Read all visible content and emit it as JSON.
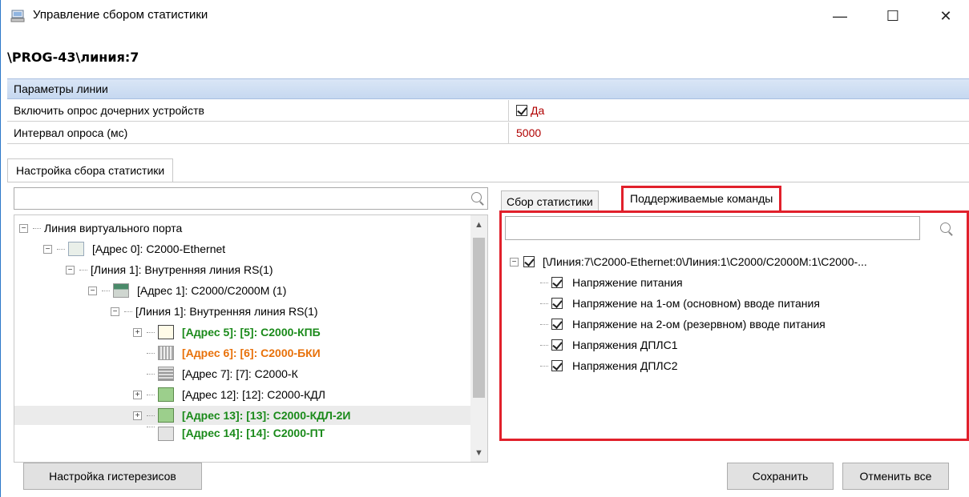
{
  "window": {
    "title": "Управление сбором статистики",
    "path": "\\PROG-43\\линия:7",
    "controls": {
      "minimize": "—",
      "maximize": "☐",
      "close": "✕"
    }
  },
  "params": {
    "header": "Параметры линии",
    "rows": [
      {
        "label": "Включить опрос дочерних устройств",
        "value": "Да",
        "checked": true
      },
      {
        "label": "Интервал опроса (мс)",
        "value": "5000"
      }
    ]
  },
  "main_tab": "Настройка сбора статистики",
  "left_tree": {
    "search_value": "",
    "nodes": [
      {
        "label": "Линия виртуального порта",
        "level": 0,
        "icon": "none"
      },
      {
        "label": "[Адрес 0]: С2000-Ethernet",
        "level": 1,
        "icon": "ethernet-icon"
      },
      {
        "label": "[Линия 1]: Внутренняя линия RS(1)",
        "level": 2,
        "icon": "none"
      },
      {
        "label": "[Адрес 1]: С2000/С2000М (1)",
        "level": 3,
        "icon": "panel-icon"
      },
      {
        "label": "[Линия 1]: Внутренняя линия RS(1)",
        "level": 4,
        "icon": "none"
      },
      {
        "label": "[Адрес 5]: [5]: С2000-КПБ",
        "level": 5,
        "icon": "graph-icon",
        "style": "green"
      },
      {
        "label": "[Адрес 6]: [6]: С2000-БКИ",
        "level": 5,
        "icon": "grid-icon",
        "style": "orange"
      },
      {
        "label": "[Адрес 7]: [7]: С2000-К",
        "level": 5,
        "icon": "keypad-icon",
        "style": "normal"
      },
      {
        "label": "[Адрес 12]: [12]: С2000-КДЛ",
        "level": 5,
        "icon": "device-icon",
        "style": "normal"
      },
      {
        "label": "[Адрес 13]: [13]: С2000-КДЛ-2И",
        "level": 5,
        "icon": "device-icon",
        "style": "green",
        "selected": true
      },
      {
        "label": "[Адрес 14]: [14]: С2000-ПТ",
        "level": 5,
        "icon": "device-icon",
        "style": "green"
      }
    ]
  },
  "right_panel": {
    "tabs": [
      "Сбор статистики",
      "Поддерживаемые команды"
    ],
    "active_tab": "Поддерживаемые команды",
    "search_value": "",
    "root": "[\\Линия:7\\С2000-Ethernet:0\\Линия:1\\С2000/С2000М:1\\С2000-...",
    "commands": [
      "Напряжение питания",
      "Напряжение на 1-ом (основном) вводе питания",
      "Напряжение на 2-ом (резервном) вводе питания",
      "Напряжения ДПЛС1",
      "Напряжения ДПЛС2"
    ]
  },
  "buttons": {
    "hysteresis": "Настройка гистерезисов",
    "save": "Сохранить",
    "cancel_all": "Отменить все"
  },
  "colors": {
    "accent_red": "#e1202b",
    "value_red": "#b00000",
    "green_text": "#1a8a1a",
    "orange_text": "#e8710a"
  }
}
